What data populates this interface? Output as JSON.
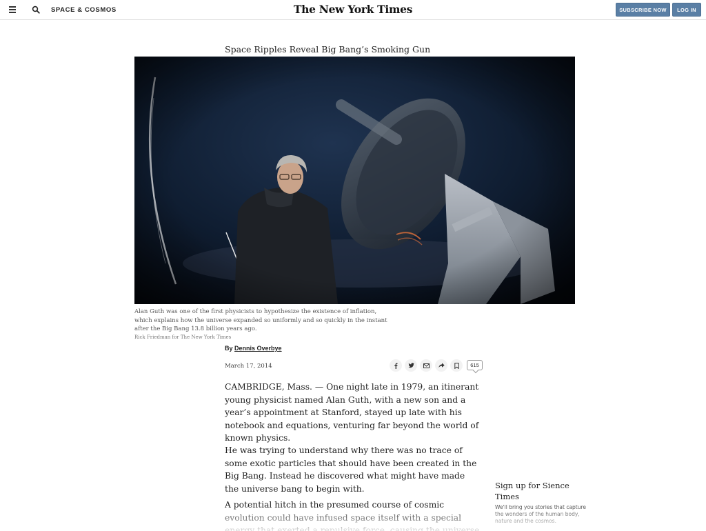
{
  "header": {
    "section": "SPACE & COSMOS",
    "masthead": "The New York Times",
    "subscribe_label": "SUBSCRIBE NOW",
    "login_label": "LOG IN",
    "accent_color": "#5a7fa5"
  },
  "article": {
    "headline": "Space Ripples Reveal Big Bang’s Smoking Gun",
    "caption": "Alan Guth was one of the first physicists to hypothesize the existence of inflation, which explains how the universe expanded so uniformly and so quickly in the instant after the Big Bang 13.8 billion years ago.",
    "credit": "Rick Friedman for The New York Times",
    "byline_prefix": "By",
    "author": "Dennis Overbye",
    "date": "March 17, 2014",
    "comment_count": "615",
    "paragraphs": [
      "CAMBRIDGE, Mass. — One night late in 1979, an itinerant young physicist named Alan Guth, with a new son and a year’s appointment at Stanford, stayed up late with his notebook and equations, venturing far beyond the world of known physics.",
      "He was trying to understand why there was no trace of some exotic particles that should have been created in the Big Bang. Instead he discovered what might have made the universe bang to begin with.",
      "A potential hitch in the presumed course of cosmic evolution could have infused space itself with a special energy that exerted a repulsive force, causing the universe to swell faster than the speed"
    ]
  },
  "share_icons": [
    "facebook-icon",
    "twitter-icon",
    "email-icon",
    "share-icon",
    "bookmark-icon"
  ],
  "signup": {
    "title": "Sign up for Sience Times",
    "description": "We'll bring you stories that capture the wonders of the human body, nature and the cosmos."
  }
}
